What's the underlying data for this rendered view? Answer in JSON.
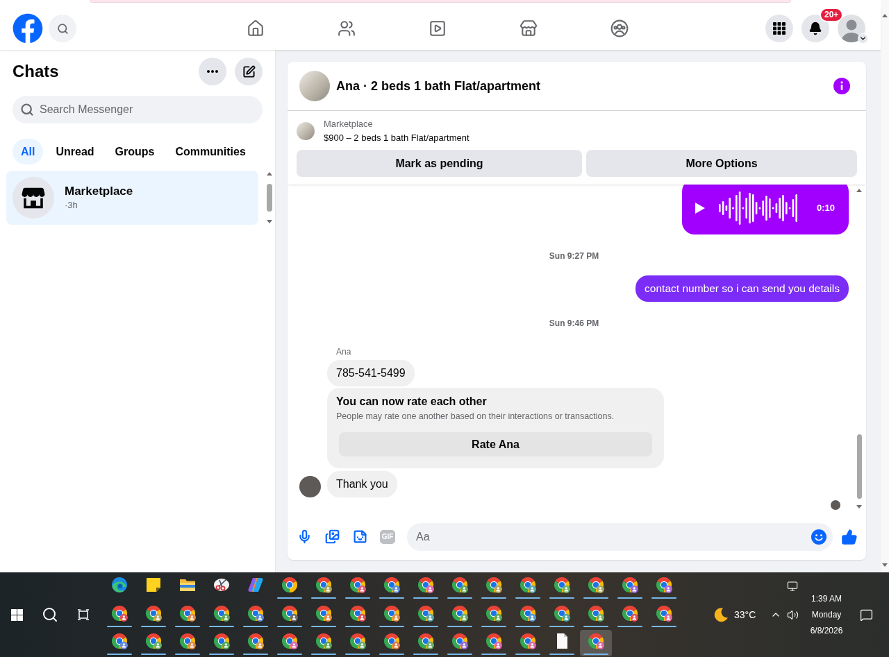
{
  "top_nav": {
    "tabs": [
      {
        "kind": "home",
        "selected": false
      },
      {
        "kind": "friends",
        "selected": false
      },
      {
        "kind": "video",
        "selected": false
      },
      {
        "kind": "marketplace",
        "selected": false
      },
      {
        "kind": "groups",
        "selected": false
      }
    ],
    "notification_badge": "20+"
  },
  "chats_panel": {
    "title": "Chats",
    "search": {
      "placeholder": "Search Messenger"
    },
    "filters": [
      {
        "label": "All",
        "selected": true
      },
      {
        "label": "Unread",
        "selected": false
      },
      {
        "label": "Groups",
        "selected": false
      },
      {
        "label": "Communities",
        "selected": false
      }
    ],
    "conversations": [
      {
        "name": "Marketplace",
        "time": "·3h",
        "selected": true
      }
    ]
  },
  "conversation": {
    "title": "Ana · 2 beds 1 bath Flat/apartment",
    "listing": {
      "source": "Marketplace",
      "summary": "$900 – 2 beds 1 bath Flat/apartment"
    },
    "actions": [
      "Mark as pending",
      "More Options"
    ],
    "messages": [
      {
        "kind": "voice",
        "duration": "0:10",
        "outgoing": true
      },
      {
        "kind": "timestamp",
        "text": "Sun 9:27 PM"
      },
      {
        "kind": "text",
        "text": "contact number so i can send you details",
        "outgoing": true
      },
      {
        "kind": "timestamp",
        "text": "Sun 9:46 PM"
      },
      {
        "kind": "sender",
        "text": "Ana"
      },
      {
        "kind": "text",
        "text": "785-541-5499",
        "outgoing": false,
        "avatar": false
      },
      {
        "kind": "rating_card",
        "title": "You can now rate each other",
        "body": "People may rate one another based on their interactions or transactions.",
        "button": "Rate Ana"
      },
      {
        "kind": "text",
        "text": "Thank you",
        "outgoing": false,
        "avatar": true
      }
    ],
    "seen": true,
    "composer": {
      "gif_label": "GIF",
      "placeholder": "Aa"
    }
  },
  "taskbar": {
    "apps": [
      {
        "kind": "edge",
        "running": false,
        "selected": false
      },
      {
        "kind": "notes",
        "running": false,
        "selected": false
      },
      {
        "kind": "folder",
        "running": false,
        "selected": false
      },
      {
        "kind": "snip",
        "running": false,
        "selected": false
      },
      {
        "kind": "copilot",
        "running": false,
        "selected": false
      },
      {
        "kind": "chrome",
        "running": true,
        "selected": false
      },
      {
        "kind": "chrome",
        "color": "#a8a35c",
        "running": true,
        "selected": false
      },
      {
        "kind": "chrome",
        "color": "#e0607a",
        "running": true,
        "selected": false
      },
      {
        "kind": "chrome",
        "color": "#5b8fd8",
        "running": true,
        "selected": false
      },
      {
        "kind": "chrome",
        "color": "#e06aa8",
        "running": true,
        "selected": false
      },
      {
        "kind": "chrome",
        "color": "#5aa55a",
        "running": true,
        "selected": false
      },
      {
        "kind": "chrome",
        "color": "#b5a35a",
        "running": true,
        "selected": false
      },
      {
        "kind": "chrome",
        "color": "#5aa8a8",
        "running": true,
        "selected": false
      },
      {
        "kind": "chrome",
        "color": "#6ab56a",
        "running": true,
        "selected": false
      },
      {
        "kind": "chrome",
        "color": "#a8a860",
        "running": true,
        "selected": false
      },
      {
        "kind": "chrome",
        "color": "#9a6ad8",
        "running": true,
        "selected": false
      },
      {
        "kind": "chrome",
        "color": "#b06ad8",
        "running": true,
        "selected": false
      },
      {
        "kind": "chrome",
        "color": "#e0505a",
        "running": true,
        "selected": false
      },
      {
        "kind": "chrome",
        "color": "#b8a860",
        "running": true,
        "selected": false
      },
      {
        "kind": "chrome",
        "color": "#e08a4a",
        "running": true,
        "selected": false
      },
      {
        "kind": "chrome",
        "color": "#5aa55a",
        "running": true,
        "selected": false
      },
      {
        "kind": "chrome",
        "color": "#5a8ad8",
        "running": true,
        "selected": false
      },
      {
        "kind": "chrome",
        "color": "#6b6b6b",
        "running": true,
        "selected": false
      },
      {
        "kind": "chrome",
        "color": "#e08a4a",
        "running": true,
        "selected": false
      },
      {
        "kind": "chrome",
        "color": "#e0505a",
        "running": true,
        "selected": false
      },
      {
        "kind": "chrome",
        "color": "#e0904a",
        "running": true,
        "selected": false
      },
      {
        "kind": "chrome",
        "color": "#5aa8b0",
        "running": true,
        "selected": false
      },
      {
        "kind": "chrome",
        "color": "#6ab06a",
        "running": true,
        "selected": false
      },
      {
        "kind": "chrome",
        "color": "#5aa55a",
        "running": true,
        "selected": false
      },
      {
        "kind": "chrome",
        "color": "#5a9ad8",
        "running": true,
        "selected": false
      },
      {
        "kind": "chrome",
        "color": "#4aa8a0",
        "running": true,
        "selected": false
      },
      {
        "kind": "chrome",
        "color": "#6ab06a",
        "running": true,
        "selected": false
      },
      {
        "kind": "chrome",
        "color": "#e0505a",
        "running": true,
        "selected": false
      },
      {
        "kind": "chrome",
        "color": "#e06a9a",
        "running": true,
        "selected": false
      },
      {
        "kind": "chrome",
        "color": "#6a8ad8",
        "running": true,
        "selected": false
      },
      {
        "kind": "chrome",
        "color": "#6ab06a",
        "running": true,
        "selected": false
      },
      {
        "kind": "chrome",
        "color": "#e08a4a",
        "running": true,
        "selected": false
      },
      {
        "kind": "chrome",
        "color": "#5aa55a",
        "running": true,
        "selected": false
      },
      {
        "kind": "chrome",
        "color": "#e0a04a",
        "running": true,
        "selected": false
      },
      {
        "kind": "chrome",
        "color": "#d86ab0",
        "running": true,
        "selected": false
      },
      {
        "kind": "chrome",
        "color": "#5aa55a",
        "running": true,
        "selected": false
      },
      {
        "kind": "chrome",
        "color": "#6ab06a",
        "running": true,
        "selected": false
      },
      {
        "kind": "chrome",
        "color": "#e07a4a",
        "running": true,
        "selected": false
      },
      {
        "kind": "chrome",
        "color": "#6ab06a",
        "running": true,
        "selected": false
      },
      {
        "kind": "chrome",
        "color": "#9a6ad8",
        "running": true,
        "selected": false
      },
      {
        "kind": "chrome",
        "color": "#e06aa8",
        "running": true,
        "selected": false
      },
      {
        "kind": "chrome",
        "color": "#e06aa8",
        "running": true,
        "selected": false
      },
      {
        "kind": "file",
        "running": true,
        "selected": false
      },
      {
        "kind": "chrome",
        "color": "#e06aa8",
        "running": true,
        "selected": true
      }
    ],
    "weather": "33°C",
    "time": "1:39 AM",
    "day": "Monday",
    "date": "6/8/2026"
  }
}
